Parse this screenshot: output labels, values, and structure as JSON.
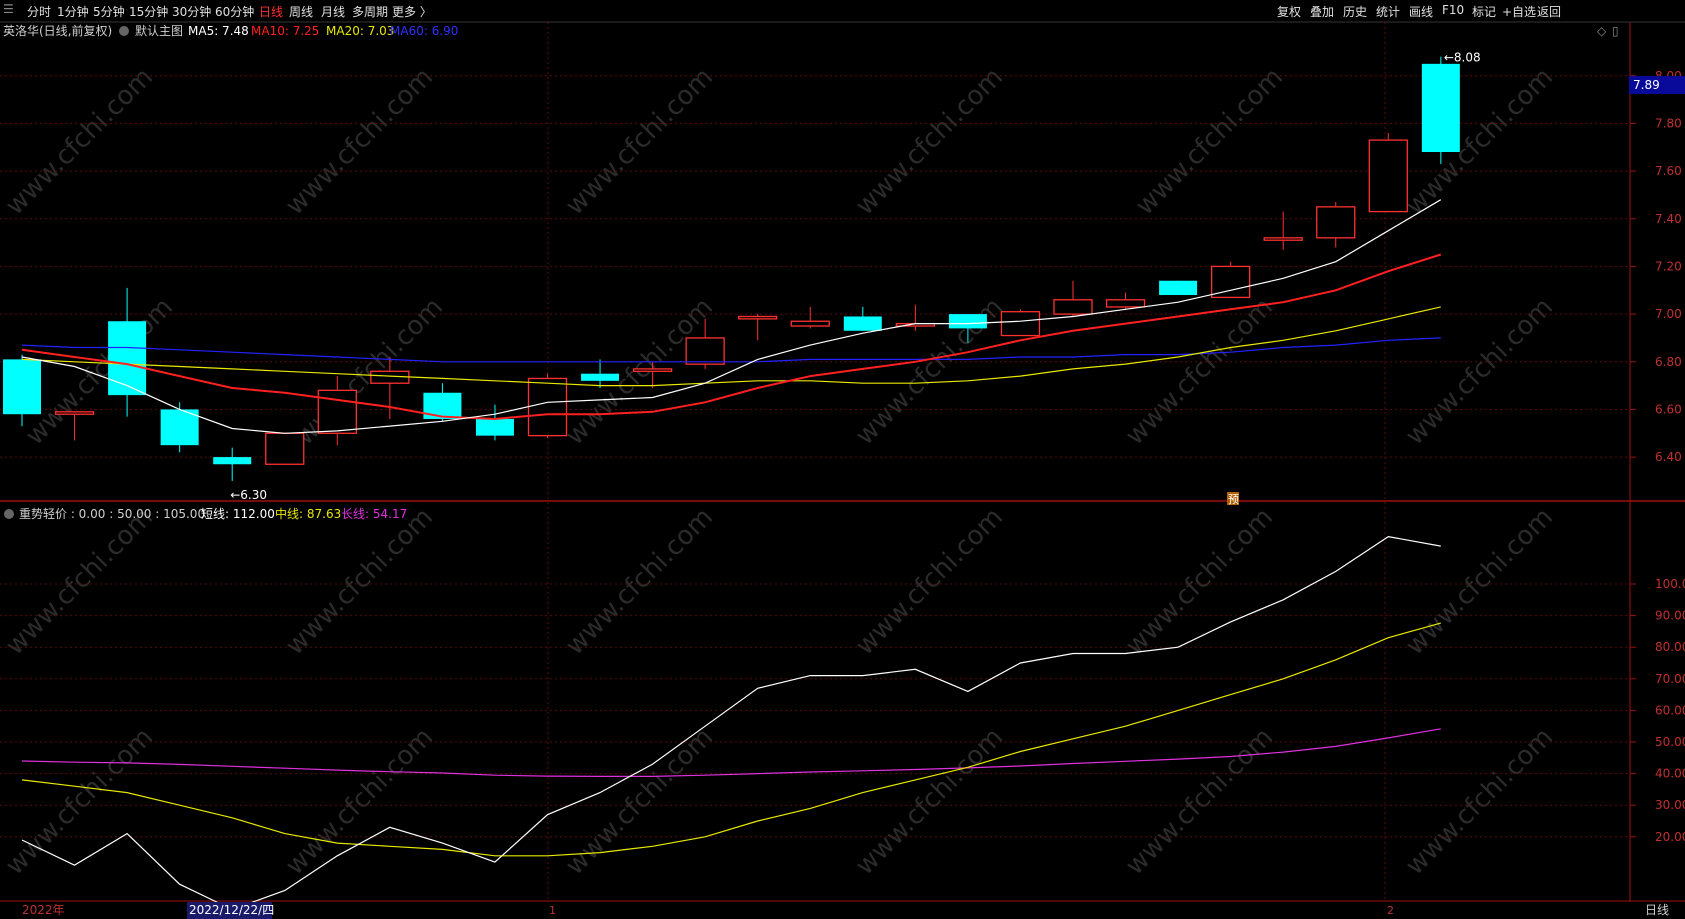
{
  "toolbar": {
    "left": [
      "分时",
      "1分钟",
      "5分钟",
      "15分钟",
      "30分钟",
      "60分钟",
      "日线",
      "周线",
      "月线",
      "多周期",
      "更多 〉"
    ],
    "active_index": 6,
    "right": [
      "复权",
      "叠加",
      "历史",
      "统计",
      "画线",
      "F10",
      "标记",
      "+自选",
      "返回"
    ]
  },
  "main_header": {
    "stock": "英洛华(日线,前复权)",
    "template": "默认主图",
    "ma5": "MA5: 7.48",
    "ma10": "MA10: 7.25",
    "ma20": "MA20: 7.03",
    "ma60": "MA60: 6.90"
  },
  "indicator_header": {
    "name": "重势轻价 : 0.00 : 50.00 : 105.00",
    "short": "短线: 112.00",
    "mid": "中线: 87.63",
    "long": "长线: 54.17"
  },
  "price_labels": {
    "high": "8.08",
    "low": "6.30",
    "current": "7.89",
    "yu": "预"
  },
  "bottom": {
    "year": "2022年",
    "date": "2022/12/22/四",
    "m1": "1",
    "m2": "2",
    "period": "日线"
  },
  "watermark": "www.cfchi.com",
  "colors": {
    "up": "#ff3030",
    "down": "#00ffff",
    "ma5": "#ffffff",
    "ma10": "#ff2020",
    "ma20": "#e8e800",
    "ma60": "#2222ff",
    "short": "#ffffff",
    "mid": "#e8e800",
    "long": "#e030e0"
  },
  "chart_data": [
    {
      "type": "candlestick",
      "title": "英洛华(日线,前复权)",
      "ylim": [
        6.22,
        8.15
      ],
      "yticks": [
        6.4,
        6.6,
        6.8,
        7.0,
        7.2,
        7.4,
        7.6,
        7.8,
        8.0
      ],
      "candles": [
        {
          "o": 6.81,
          "h": 6.83,
          "l": 6.53,
          "c": 6.58
        },
        {
          "o": 6.58,
          "h": 6.59,
          "l": 6.47,
          "c": 6.59
        },
        {
          "o": 6.97,
          "h": 7.11,
          "l": 6.57,
          "c": 6.66
        },
        {
          "o": 6.6,
          "h": 6.63,
          "l": 6.42,
          "c": 6.45
        },
        {
          "o": 6.4,
          "h": 6.44,
          "l": 6.3,
          "c": 6.37
        },
        {
          "o": 6.37,
          "h": 6.5,
          "l": 6.37,
          "c": 6.5
        },
        {
          "o": 6.5,
          "h": 6.74,
          "l": 6.45,
          "c": 6.68
        },
        {
          "o": 6.71,
          "h": 6.82,
          "l": 6.56,
          "c": 6.76
        },
        {
          "o": 6.67,
          "h": 6.71,
          "l": 6.55,
          "c": 6.56
        },
        {
          "o": 6.56,
          "h": 6.62,
          "l": 6.47,
          "c": 6.49
        },
        {
          "o": 6.49,
          "h": 6.75,
          "l": 6.48,
          "c": 6.73
        },
        {
          "o": 6.75,
          "h": 6.81,
          "l": 6.69,
          "c": 6.72
        },
        {
          "o": 6.76,
          "h": 6.8,
          "l": 6.69,
          "c": 6.77
        },
        {
          "o": 6.79,
          "h": 6.98,
          "l": 6.77,
          "c": 6.9
        },
        {
          "o": 6.98,
          "h": 7.0,
          "l": 6.89,
          "c": 6.99
        },
        {
          "o": 6.95,
          "h": 7.03,
          "l": 6.94,
          "c": 6.97
        },
        {
          "o": 6.99,
          "h": 7.03,
          "l": 6.93,
          "c": 6.93
        },
        {
          "o": 6.95,
          "h": 7.04,
          "l": 6.93,
          "c": 6.96
        },
        {
          "o": 7.0,
          "h": 7.0,
          "l": 6.88,
          "c": 6.94
        },
        {
          "o": 6.91,
          "h": 7.02,
          "l": 6.91,
          "c": 7.01
        },
        {
          "o": 7.0,
          "h": 7.14,
          "l": 6.99,
          "c": 7.06
        },
        {
          "o": 7.03,
          "h": 7.09,
          "l": 7.02,
          "c": 7.06
        },
        {
          "o": 7.14,
          "h": 7.14,
          "l": 7.08,
          "c": 7.08
        },
        {
          "o": 7.07,
          "h": 7.22,
          "l": 7.07,
          "c": 7.2
        },
        {
          "o": 7.31,
          "h": 7.43,
          "l": 7.27,
          "c": 7.32
        },
        {
          "o": 7.32,
          "h": 7.47,
          "l": 7.28,
          "c": 7.45
        },
        {
          "o": 7.43,
          "h": 7.76,
          "l": 7.43,
          "c": 7.73
        },
        {
          "o": 8.05,
          "h": 8.08,
          "l": 7.63,
          "c": 7.68
        }
      ],
      "ma5": [
        6.82,
        6.78,
        6.7,
        6.6,
        6.52,
        6.5,
        6.51,
        6.53,
        6.55,
        6.58,
        6.63,
        6.64,
        6.65,
        6.71,
        6.81,
        6.87,
        6.92,
        6.96,
        6.96,
        6.97,
        6.99,
        7.02,
        7.05,
        7.1,
        7.15,
        7.22,
        7.35,
        7.48
      ],
      "ma10": [
        6.85,
        6.82,
        6.79,
        6.74,
        6.69,
        6.67,
        6.64,
        6.61,
        6.57,
        6.56,
        6.58,
        6.58,
        6.59,
        6.63,
        6.69,
        6.74,
        6.77,
        6.8,
        6.84,
        6.89,
        6.93,
        6.96,
        6.99,
        7.02,
        7.05,
        7.1,
        7.18,
        7.25
      ],
      "ma20": [
        6.81,
        6.8,
        6.79,
        6.78,
        6.77,
        6.76,
        6.75,
        6.74,
        6.73,
        6.72,
        6.71,
        6.7,
        6.7,
        6.71,
        6.72,
        6.72,
        6.71,
        6.71,
        6.72,
        6.74,
        6.77,
        6.79,
        6.82,
        6.86,
        6.89,
        6.93,
        6.98,
        7.03
      ],
      "ma60": [
        6.87,
        6.86,
        6.86,
        6.85,
        6.84,
        6.83,
        6.82,
        6.81,
        6.8,
        6.8,
        6.8,
        6.8,
        6.8,
        6.8,
        6.8,
        6.81,
        6.81,
        6.81,
        6.81,
        6.82,
        6.82,
        6.83,
        6.83,
        6.84,
        6.86,
        6.87,
        6.89,
        6.9
      ]
    },
    {
      "type": "line",
      "title": "重势轻价",
      "ylim": [
        0,
        125
      ],
      "yticks": [
        20,
        30,
        40,
        50,
        60,
        70,
        80,
        90,
        100
      ],
      "series": [
        {
          "name": "短线",
          "values": [
            19,
            11,
            21,
            5,
            -3,
            3,
            14,
            23,
            18,
            12,
            27,
            34,
            43,
            55,
            67,
            71,
            71,
            73,
            66,
            75,
            78,
            78,
            80,
            88,
            95,
            104,
            115,
            112
          ]
        },
        {
          "name": "中线",
          "values": [
            38,
            36,
            34,
            30,
            26,
            21,
            18,
            17,
            16,
            14,
            14,
            15,
            17,
            20,
            25,
            29,
            34,
            38,
            42,
            47,
            51,
            55,
            60,
            65,
            70,
            76,
            83,
            87.63
          ]
        },
        {
          "name": "长线",
          "values": [
            44,
            43.6,
            43.4,
            42.9,
            42.3,
            41.7,
            41.1,
            40.6,
            40.2,
            39.5,
            39.2,
            39.1,
            39.1,
            39.5,
            40,
            40.5,
            40.9,
            41.3,
            41.8,
            42.4,
            43.2,
            43.9,
            44.6,
            45.4,
            46.8,
            48.6,
            51.3,
            54.17
          ]
        }
      ]
    }
  ]
}
